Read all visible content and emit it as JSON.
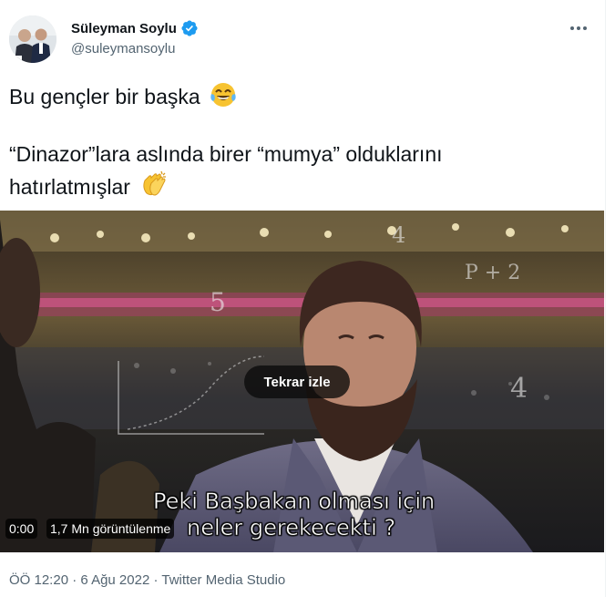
{
  "author": {
    "display_name": "Süleyman Soylu",
    "handle": "@suleymansoylu",
    "verified": true,
    "verified_color": "#1d9bf0",
    "avatar_icon": "avatar-photo-icon",
    "more_icon": "more-options-icon"
  },
  "tweet": {
    "line1": "Bu gençler bir başka",
    "line1_emoji": "face-with-tears-of-joy-icon",
    "line2": "“Dinazor”lara aslında birer “mumya” olduklarını",
    "line3": "hatırlatmışlar",
    "line3_emoji": "clapping-hands-icon"
  },
  "video": {
    "replay_label": "Tekrar izle",
    "subtitle_line1": "Peki Başbakan olması için",
    "subtitle_line2": "neler gerekecekti ?",
    "time": "0:00",
    "views": "1,7 Mn görüntülenme"
  },
  "meta": {
    "time": "ÖÖ 12:20",
    "separator1": " · ",
    "date": "6 Ağu 2022",
    "separator2": " · ",
    "source": "Twitter Media Studio"
  },
  "colors": {
    "text": "#0f1419",
    "secondary": "#536471",
    "accent": "#1d9bf0"
  }
}
